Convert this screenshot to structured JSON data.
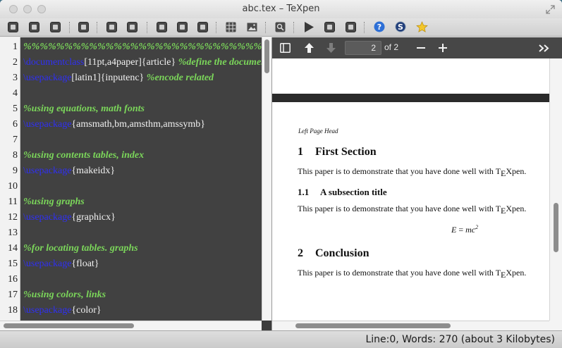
{
  "window": {
    "title": "abc.tex – TeXpen"
  },
  "toolbar": {
    "buttons": [
      "new-file-icon",
      "open-file-icon",
      "save-file-icon",
      "print-icon",
      "undo-icon",
      "redo-icon",
      "cut-icon",
      "copy-icon",
      "paste-icon",
      "table-icon",
      "image-icon",
      "find-icon",
      "compile-icon",
      "console-icon",
      "settings-icon",
      "help-icon",
      "spell-check-icon",
      "favorites-icon"
    ]
  },
  "editor": {
    "lines": [
      {
        "num": "1",
        "parts": [
          {
            "cls": "cmt",
            "text": "%%%%%%%%%%%%%%%%%%%%%%%%%%%%%%%%%%%%%%%%%%%%%%%"
          }
        ]
      },
      {
        "num": "2",
        "parts": [
          {
            "cls": "kw",
            "text": "\\documentclass"
          },
          {
            "cls": "arg",
            "text": "[11pt,a4paper]{article} "
          },
          {
            "cls": "cmt",
            "text": "%define the document"
          }
        ]
      },
      {
        "num": "3",
        "parts": [
          {
            "cls": "kw",
            "text": "\\usepackage"
          },
          {
            "cls": "arg",
            "text": "[latin1]{inputenc} "
          },
          {
            "cls": "cmt",
            "text": "%encode related"
          }
        ]
      },
      {
        "num": "4",
        "parts": []
      },
      {
        "num": "5",
        "parts": [
          {
            "cls": "cmt",
            "text": "%using equations, math fonts"
          }
        ]
      },
      {
        "num": "6",
        "parts": [
          {
            "cls": "kw",
            "text": "\\usepackage"
          },
          {
            "cls": "arg",
            "text": "{amsmath,bm,amsthm,amssymb}"
          }
        ]
      },
      {
        "num": "7",
        "parts": []
      },
      {
        "num": "8",
        "parts": [
          {
            "cls": "cmt",
            "text": "%using contents tables, index"
          }
        ]
      },
      {
        "num": "9",
        "parts": [
          {
            "cls": "kw",
            "text": "\\usepackage"
          },
          {
            "cls": "arg",
            "text": "{makeidx}"
          }
        ]
      },
      {
        "num": "10",
        "parts": []
      },
      {
        "num": "11",
        "parts": [
          {
            "cls": "cmt",
            "text": "%using graphs"
          }
        ]
      },
      {
        "num": "12",
        "parts": [
          {
            "cls": "kw",
            "text": "\\usepackage"
          },
          {
            "cls": "arg",
            "text": "{graphicx}"
          }
        ]
      },
      {
        "num": "13",
        "parts": []
      },
      {
        "num": "14",
        "parts": [
          {
            "cls": "cmt",
            "text": "%for locating tables. graphs"
          }
        ]
      },
      {
        "num": "15",
        "parts": [
          {
            "cls": "kw",
            "text": "\\usepackage"
          },
          {
            "cls": "arg",
            "text": "{float}"
          }
        ]
      },
      {
        "num": "16",
        "parts": []
      },
      {
        "num": "17",
        "parts": [
          {
            "cls": "cmt",
            "text": "%using colors, links"
          }
        ]
      },
      {
        "num": "18",
        "parts": [
          {
            "cls": "kw",
            "text": "\\usepackage"
          },
          {
            "cls": "arg",
            "text": "{color}"
          }
        ]
      }
    ]
  },
  "viewer": {
    "current_page": "2",
    "of_pages": "of 2",
    "page": {
      "running_head": "Left Page Head",
      "section1_num": "1",
      "section1_title": "First Section",
      "para1": "This paper is to demonstrate that you have done well with T",
      "subsection_num": "1.1",
      "subsection_title": "A subsection title",
      "para2": "This paper is to demonstrate that you have done well with T",
      "equation_lhs": "E",
      "equation_eq": " = ",
      "equation_rhs": "mc",
      "equation_exp": "2",
      "section2_num": "2",
      "section2_title": "Conclusion",
      "para3": "This paper is to demonstrate that you have done well with T",
      "logo_e": "E",
      "logo_tail": "Xpen."
    }
  },
  "status": {
    "text": "Line:0, Words: 270 (about 3 Kilobytes)"
  },
  "colors": {
    "comment": "#7bd65a",
    "keyword": "#2f2ff5",
    "editor_bg": "#414141",
    "viewer_toolbar": "#474747"
  }
}
